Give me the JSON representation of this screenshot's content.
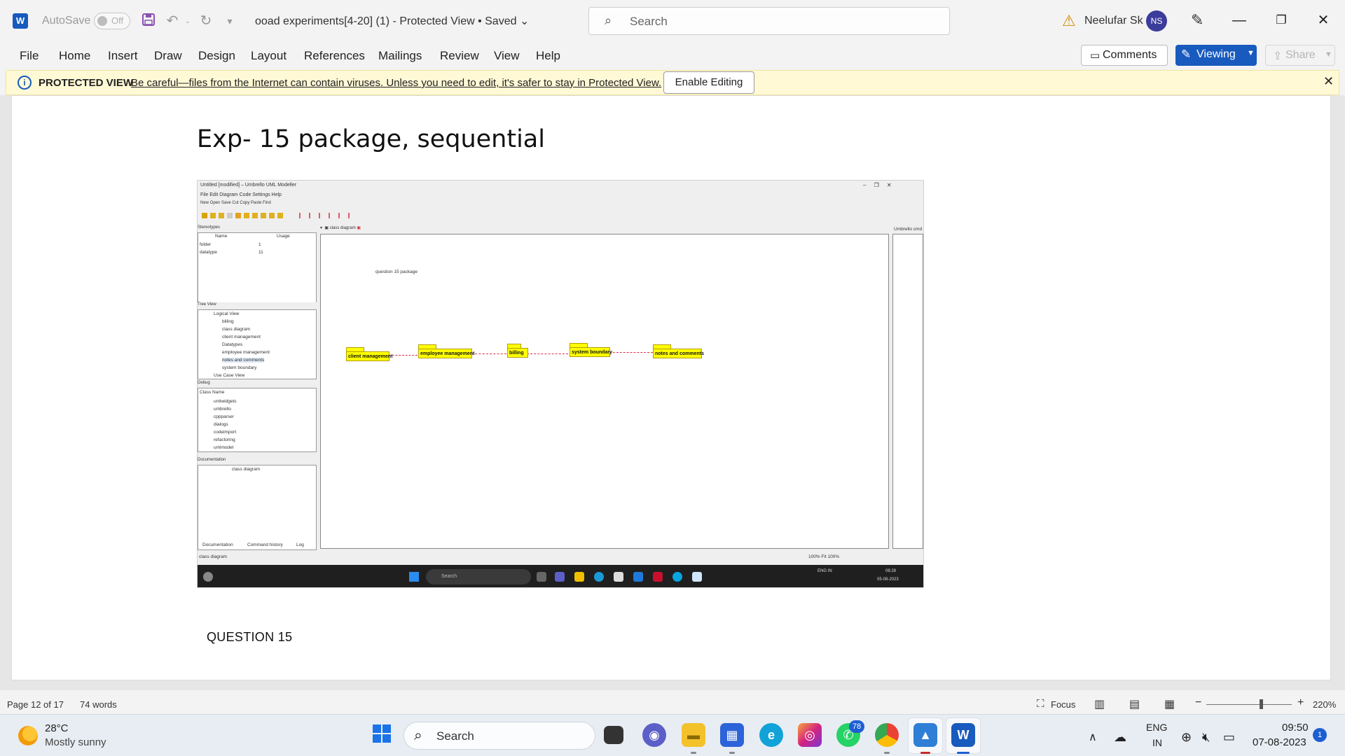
{
  "titlebar": {
    "autosave_label": "AutoSave",
    "autosave_state": "Off",
    "doc_title": "ooad experiments[4-20] (1)  -  Protected View • Saved",
    "search_placeholder": "Search",
    "user_name": "Neelufar Sk",
    "user_initials": "NS"
  },
  "menu": {
    "items": [
      "File",
      "Home",
      "Insert",
      "Draw",
      "Design",
      "Layout",
      "References",
      "Mailings",
      "Review",
      "View",
      "Help"
    ],
    "comments_label": "Comments",
    "viewing_label": "Viewing",
    "share_label": "Share"
  },
  "protected_view": {
    "title": "PROTECTED VIEW",
    "message": "Be careful—files from the Internet can contain viruses. Unless you need to edit, it's safer to stay in Protected View.",
    "enable_button": "Enable Editing"
  },
  "document": {
    "heading": "Exp- 15 package, sequential",
    "caption": "QUESTION 15",
    "embedded_screenshot": {
      "window_title": "Untitled [modified] – Umbrello UML Modeller",
      "menu": "File   Edit   Diagram   Code   Settings   Help",
      "toolbar": "New   Open   Save   Cut   Copy   Paste   Find",
      "stereotypes_panel": {
        "title": "Stereotypes",
        "col_name": "Name",
        "col_usage": "Usage",
        "rows": [
          {
            "name": "folder",
            "usage": "1"
          },
          {
            "name": "datatype",
            "usage": "11"
          }
        ]
      },
      "tree_view": {
        "title": "Tree View",
        "items": [
          "Logical View",
          "billing",
          "class diagram",
          "client management",
          "Datatypes",
          "employee management",
          "notes and comments",
          "system boundary",
          "Use Case View"
        ]
      },
      "debug_panel": {
        "title": "Debug",
        "header": "Class Name",
        "items": [
          "umlwidgets",
          "umbrello",
          "cppparser",
          "dialogs",
          "codeimport",
          "refactoring",
          "umlmodel"
        ]
      },
      "documentation_panel": {
        "title": "Documentation",
        "value": "class diagram",
        "tabs": [
          "Documentation",
          "Command history",
          "Log"
        ]
      },
      "diagram_tab": "class diagram",
      "diagram_label": "question 15 package",
      "packages": [
        "client management",
        "employee management",
        "billing",
        "system boundary",
        "notes and comments"
      ],
      "status_left": "class diagram",
      "status_right": "100%   Fit   100%",
      "right_panel_title": "Umbrello cmd",
      "taskbar": {
        "search": "Search",
        "lang": "ENG IN",
        "time": "08:28",
        "date": "05-08-2023"
      }
    }
  },
  "statusbar": {
    "page": "Page 12 of 17",
    "words": "74 words",
    "focus": "Focus",
    "zoom": "220%"
  },
  "taskbar": {
    "weather_temp": "28°C",
    "weather_desc": "Mostly sunny",
    "search_label": "Search",
    "whatsapp_badge": "78",
    "lang_line1": "ENG",
    "lang_line2": "IN",
    "time": "09:50",
    "date": "07-08-2023",
    "notifications": "1"
  },
  "colors": {
    "word_blue": "#185abd",
    "protected_bar": "#fff9d6",
    "package_fill": "#ffff00",
    "dependency": "#e0304e"
  }
}
